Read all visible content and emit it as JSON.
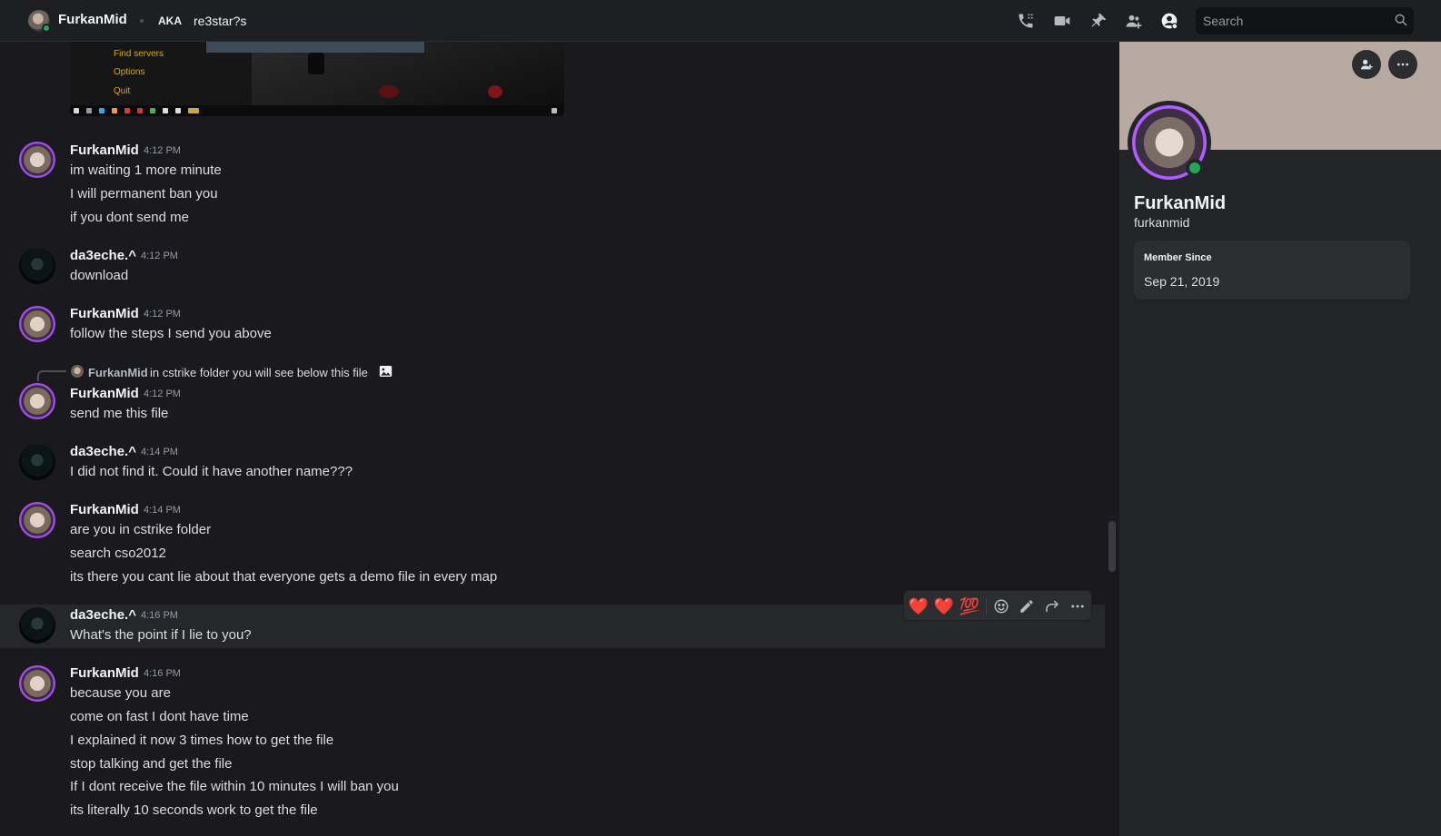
{
  "header": {
    "name": "FurkanMid",
    "aka_label": "AKA",
    "alias": "re3star?s",
    "search_placeholder": "Search",
    "icons": [
      "phone-call-icon",
      "video-camera-icon",
      "pin-icon",
      "add-friend-icon",
      "user-profile-icon",
      "search-icon"
    ]
  },
  "embed": {
    "menu": [
      "Find servers",
      "Options",
      "Quit"
    ]
  },
  "messages": [
    {
      "author": "FurkanMid",
      "time": "4:12 PM",
      "lines": [
        "im waiting 1 more minute",
        "I will permanent ban you",
        "if you dont send me"
      ]
    },
    {
      "author": "da3eche.^",
      "time": "4:12 PM",
      "lines": [
        "download"
      ]
    },
    {
      "author": "FurkanMid",
      "time": "4:12 PM",
      "lines": [
        "follow the steps I send you above"
      ]
    },
    {
      "author": "FurkanMid",
      "time": "4:12 PM",
      "lines": [
        "send me this file"
      ],
      "reply": {
        "author": "FurkanMid",
        "text": "in cstrike folder you will see below this file"
      }
    },
    {
      "author": "da3eche.^",
      "time": "4:14 PM",
      "lines": [
        "I did not find it. Could it have another name???"
      ]
    },
    {
      "author": "FurkanMid",
      "time": "4:14 PM",
      "lines": [
        "are you in cstrike folder",
        "search cso2012",
        "its there you cant lie about that everyone gets a demo file in every map"
      ]
    },
    {
      "author": "da3eche.^",
      "time": "4:16 PM",
      "lines": [
        "What's the point if I lie to you?"
      ]
    },
    {
      "author": "FurkanMid",
      "time": "4:16 PM",
      "lines": [
        "because you are",
        "come on fast I dont have time",
        "I explained it now 3 times how to get the file",
        "stop talking and get the file",
        "If I dont receive the file within 10 minutes I will ban you",
        "its literally 10 seconds work to get the file"
      ]
    }
  ],
  "toolbar": {
    "reactions": [
      "❤️",
      "❤️",
      "💯"
    ],
    "actions": [
      "add-reaction-icon",
      "edit-icon",
      "forward-icon",
      "more-icon"
    ]
  },
  "profile": {
    "display_name": "FurkanMid",
    "username": "furkanmid",
    "member_since_label": "Member Since",
    "member_since": "Sep 21, 2019",
    "status_color": "#23a55a"
  }
}
